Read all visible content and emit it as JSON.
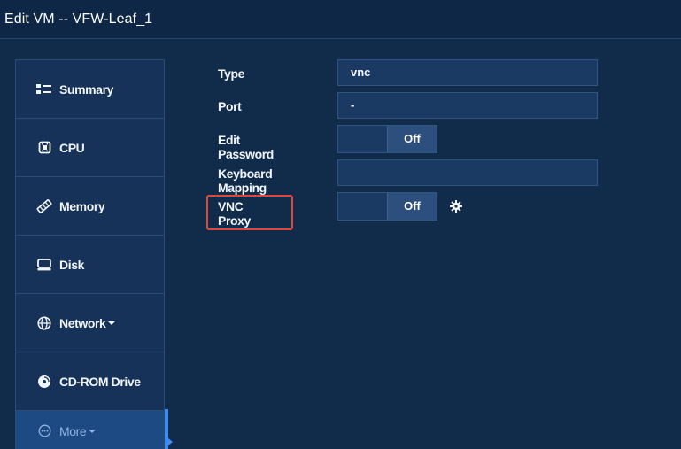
{
  "window": {
    "title": "Edit VM -- VFW-Leaf_1"
  },
  "nav": {
    "items": [
      {
        "label": "Summary",
        "icon": "list-icon"
      },
      {
        "label": "CPU",
        "icon": "cpu-chip-icon"
      },
      {
        "label": "Memory",
        "icon": "memory-stick-icon"
      },
      {
        "label": "Disk",
        "icon": "disk-drive-icon"
      },
      {
        "label": "Network",
        "icon": "globe-icon",
        "has_dropdown": true
      },
      {
        "label": "CD-ROM Drive",
        "icon": "cd-disc-icon"
      },
      {
        "label": "More",
        "icon": "ellipsis-circle-icon",
        "has_dropdown": true,
        "active": true
      }
    ]
  },
  "form": {
    "type": {
      "label": "Type",
      "value": "vnc"
    },
    "port": {
      "label": "Port",
      "value": "-"
    },
    "edit_password": {
      "label": "Edit Password",
      "state": "Off"
    },
    "keyboard_mapping": {
      "label": "Keyboard Mapping",
      "value": ""
    },
    "vnc_proxy": {
      "label": "VNC Proxy",
      "state": "Off",
      "settings_icon": "gear-icon",
      "highlighted": true
    }
  },
  "colors": {
    "background": "#112b4b",
    "nav_active": "#1d4a82",
    "accent": "#3e8cf2",
    "highlight_box": "#e2463b"
  }
}
